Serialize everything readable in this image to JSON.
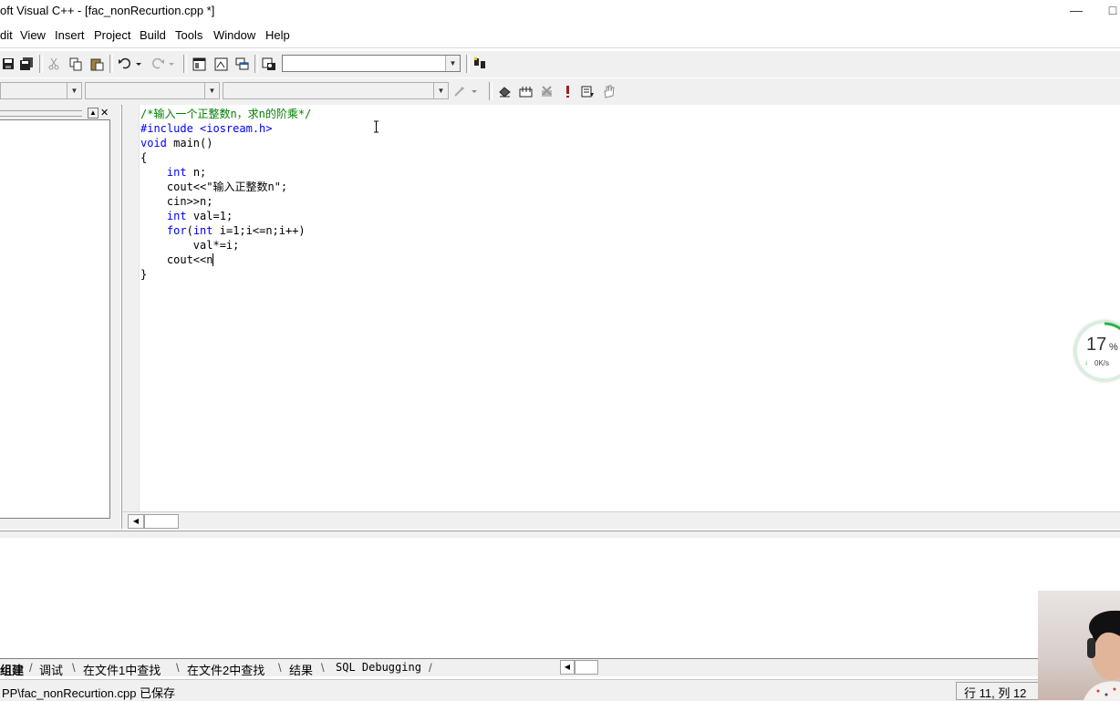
{
  "window": {
    "title": "oft Visual C++ - [fac_nonRecurtion.cpp *]",
    "minimize": "—",
    "restore": "□"
  },
  "menu": [
    "dit",
    "View",
    "Insert",
    "Project",
    "Build",
    "Tools",
    "Window",
    "Help"
  ],
  "code": {
    "line1": "/*输入一个正整数n，求n的阶乘*/",
    "line2": "#include <iosream.h>",
    "line3_kw": "void",
    "line3_rest": " main()",
    "line4": "{",
    "line5_kw": "int",
    "line5_rest": " n;",
    "line6": "    cout<<\"输入正整数n\";",
    "line7": "    cin>>n;",
    "line8_kw": "int",
    "line8_rest": " val=1;",
    "line9_kw1": "for",
    "line9_mid": "(",
    "line9_kw2": "int",
    "line9_rest": " i=1;i<=n;i++)",
    "line10": "        val*=i;",
    "line11": "    cout<<n",
    "line12": "}"
  },
  "output_tabs": [
    "组建",
    "调试",
    "在文件1中查找",
    "在文件2中查找",
    "结果",
    "SQL Debugging"
  ],
  "status": {
    "message": "PP\\fac_nonRecurtion.cpp 已保存",
    "position": "行 11, 列 12"
  },
  "gauge": {
    "percent": "17",
    "unit": "%",
    "speed": "0K/s",
    "arrow": "↓"
  },
  "colors": {
    "keyword": "#0000ff",
    "comment": "#008000",
    "gauge_ring": "#2bb34a"
  }
}
